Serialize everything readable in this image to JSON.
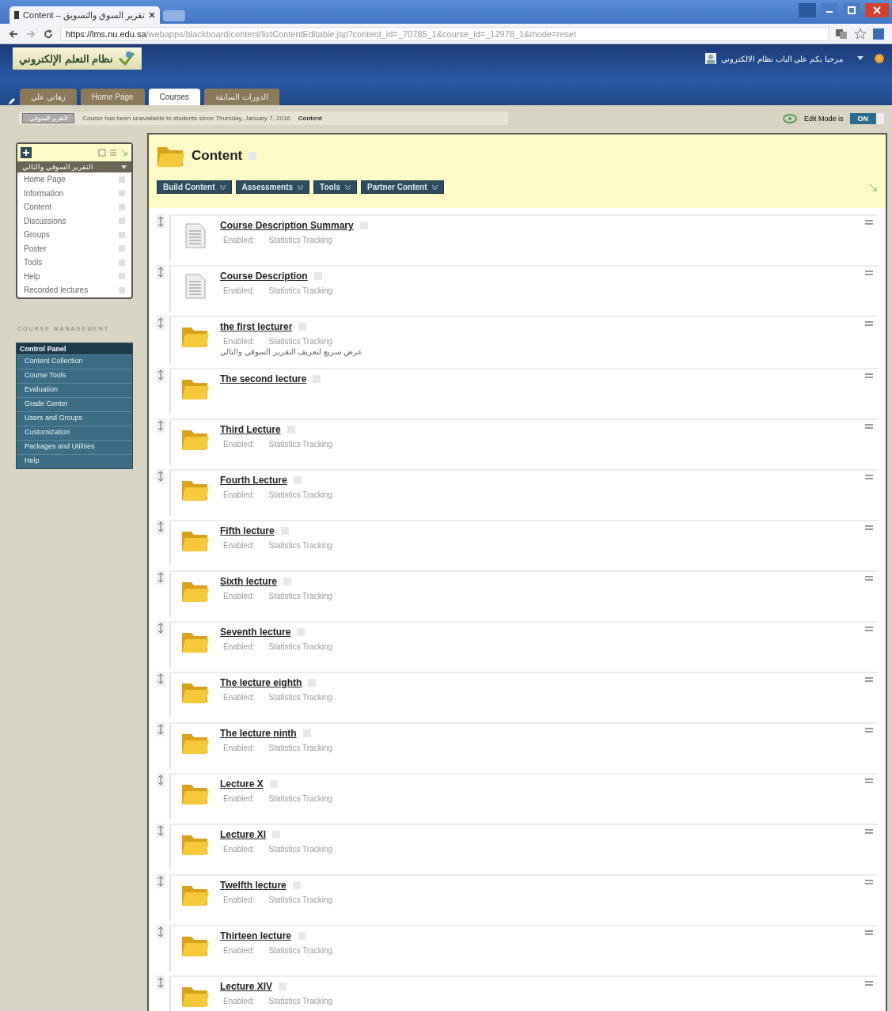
{
  "browser": {
    "tab_title": "Content – تقرير السوق والتسويق",
    "url_host": "https://lms.nu.edu.sa",
    "url_path": "/webapps/blackboard/content/listContentEditable.jsp?content_id=_70785_1&course_id=_12978_1&mode=reset"
  },
  "header": {
    "logo_text": "نظام التعلم الإلكتروني",
    "user_name": "مرحبا بكم علي الباب نظام الالكتروني"
  },
  "tabs": [
    {
      "label": "زهاتي علي",
      "selected": false
    },
    {
      "label": "Home Page",
      "selected": false
    },
    {
      "label": "Courses",
      "selected": true
    },
    {
      "label": "الدورات السابقة",
      "selected": false
    }
  ],
  "breadcrumb": {
    "course": "التقرير السوقي",
    "notice": "Course has been unavailable to students since Thursday, January 7, 2016",
    "current": "Content"
  },
  "edit_mode": {
    "label": "Edit Mode is",
    "on": true,
    "value": "ON"
  },
  "course_menu": {
    "title": "التقرير السوقي والتالي",
    "items": [
      "Home Page",
      "Information",
      "Content",
      "Discussions",
      "Groups",
      "Poster",
      "Tools",
      "Help",
      "Recorded lectures"
    ]
  },
  "course_management": {
    "heading": "COURSE MANAGEMENT",
    "panel_title": "Control Panel",
    "items": [
      "Content Collection",
      "Course Tools",
      "Evaluation",
      "Grade Center",
      "Users and Groups",
      "Customization",
      "Packages and Utilities",
      "Help"
    ]
  },
  "content": {
    "title": "Content",
    "actions": [
      "Build Content",
      "Assessments",
      "Tools",
      "Partner Content"
    ],
    "items": [
      {
        "kind": "document",
        "title": "Course Description Summary",
        "status": "Enabled:",
        "tracking": "Statistics Tracking"
      },
      {
        "kind": "document",
        "title": "Course Description",
        "status": "Enabled:",
        "tracking": "Statistics Tracking"
      },
      {
        "kind": "folder",
        "title": "the first lecturer",
        "status": "Enabled:",
        "tracking": "Statistics Tracking",
        "description": "عرض سريع لتعريف التقرير السوقي والتالي"
      },
      {
        "kind": "folder",
        "title": "The second lecture"
      },
      {
        "kind": "folder",
        "title": "Third Lecture",
        "status": "Enabled:",
        "tracking": "Statistics Tracking"
      },
      {
        "kind": "folder",
        "title": "Fourth Lecture",
        "status": "Enabled:",
        "tracking": "Statistics Tracking"
      },
      {
        "kind": "folder",
        "title": "Fifth lecture",
        "status": "Enabled:",
        "tracking": "Statistics Tracking"
      },
      {
        "kind": "folder",
        "title": "Sixth lecture",
        "status": "Enabled:",
        "tracking": "Statistics Tracking"
      },
      {
        "kind": "folder",
        "title": "Seventh lecture",
        "status": "Enabled:",
        "tracking": "Statistics Tracking"
      },
      {
        "kind": "folder",
        "title": "The lecture eighth",
        "status": "Enabled:",
        "tracking": "Statistics Tracking"
      },
      {
        "kind": "folder",
        "title": "The lecture ninth",
        "status": "Enabled:",
        "tracking": "Statistics Tracking"
      },
      {
        "kind": "folder",
        "title": "Lecture X",
        "status": "Enabled:",
        "tracking": "Statistics Tracking"
      },
      {
        "kind": "folder",
        "title": "Lecture XI",
        "status": "Enabled:",
        "tracking": "Statistics Tracking"
      },
      {
        "kind": "folder",
        "title": "Twelfth lecture",
        "status": "Enabled:",
        "tracking": "Statistics Tracking"
      },
      {
        "kind": "folder",
        "title": "Thirteen lecture",
        "status": "Enabled:",
        "tracking": "Statistics Tracking"
      },
      {
        "kind": "folder",
        "title": "Lecture XIV",
        "status": "Enabled:",
        "tracking": "Statistics Tracking"
      }
    ]
  }
}
